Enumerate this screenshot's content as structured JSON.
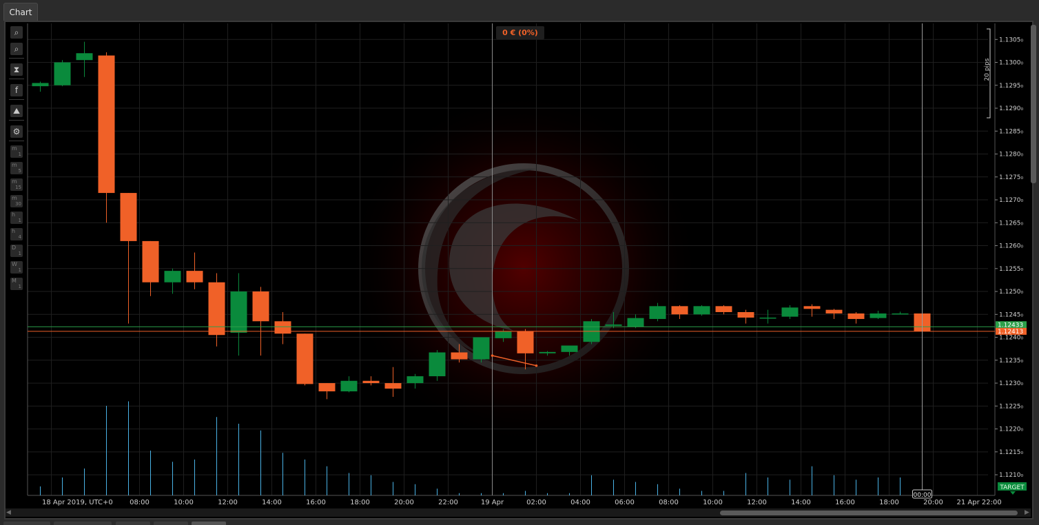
{
  "tab": {
    "label": "Chart"
  },
  "pnl": {
    "text": "0 € (0%)"
  },
  "pips_label": "20 pips",
  "toolbar": {
    "timeframes": [
      {
        "main": "m",
        "sub": "1"
      },
      {
        "main": "m",
        "sub": "5"
      },
      {
        "main": "m",
        "sub": "15"
      },
      {
        "main": "m",
        "sub": "30"
      },
      {
        "main": "h",
        "sub": "1"
      },
      {
        "main": "h",
        "sub": "4"
      },
      {
        "main": "D",
        "sub": "1"
      },
      {
        "main": "W",
        "sub": "1"
      },
      {
        "main": "M",
        "sub": "1"
      }
    ]
  },
  "colors": {
    "bull": "#0a8a3c",
    "bear": "#f06128",
    "volume": "#4ab4e8",
    "ask_line": "#2aa04a",
    "bid_line": "#f06128"
  },
  "chart_data": {
    "type": "candlestick",
    "symbol_timeframe": "H1",
    "ylim": [
      1.12055,
      1.13085
    ],
    "y_ticks": [
      "1.1305₀",
      "1.1300₀",
      "1.1295₀",
      "1.1290₀",
      "1.1285₀",
      "1.1280₀",
      "1.1275₀",
      "1.1270₀",
      "1.1265₀",
      "1.1260₀",
      "1.1255₀",
      "1.1250₀",
      "1.1245₀",
      "1.1240₀",
      "1.1235₀",
      "1.1230₀",
      "1.1225₀",
      "1.1220₀",
      "1.1215₀",
      "1.1210₀"
    ],
    "x_labels": [
      {
        "slot": 0.5,
        "text": "18 Apr 2019, UTC+0"
      },
      {
        "slot": 4.5,
        "text": "08:00"
      },
      {
        "slot": 6.5,
        "text": "10:00"
      },
      {
        "slot": 8.5,
        "text": "12:00"
      },
      {
        "slot": 10.5,
        "text": "14:00"
      },
      {
        "slot": 12.5,
        "text": "16:00"
      },
      {
        "slot": 14.5,
        "text": "18:00"
      },
      {
        "slot": 16.5,
        "text": "20:00"
      },
      {
        "slot": 18.5,
        "text": "22:00"
      },
      {
        "slot": 20.5,
        "text": "19 Apr"
      },
      {
        "slot": 22.5,
        "text": "02:00"
      },
      {
        "slot": 24.5,
        "text": "04:00"
      },
      {
        "slot": 26.5,
        "text": "06:00"
      },
      {
        "slot": 28.5,
        "text": "08:00"
      },
      {
        "slot": 30.5,
        "text": "10:00"
      },
      {
        "slot": 32.5,
        "text": "12:00"
      },
      {
        "slot": 34.5,
        "text": "14:00"
      },
      {
        "slot": 36.5,
        "text": "16:00"
      },
      {
        "slot": 38.5,
        "text": "18:00"
      },
      {
        "slot": 40.5,
        "text": "20:00"
      },
      {
        "slot": 42.5,
        "text": "21 Apr 22:00"
      }
    ],
    "candles": [
      {
        "o": 1.12948,
        "h": 1.12958,
        "l": 1.12936,
        "c": 1.12955
      },
      {
        "o": 1.1295,
        "h": 1.13005,
        "l": 1.12948,
        "c": 1.13
      },
      {
        "o": 1.13005,
        "h": 1.13045,
        "l": 1.12968,
        "c": 1.1302
      },
      {
        "o": 1.13015,
        "h": 1.13022,
        "l": 1.1265,
        "c": 1.12715
      },
      {
        "o": 1.12715,
        "h": 1.12715,
        "l": 1.1243,
        "c": 1.1261
      },
      {
        "o": 1.1261,
        "h": 1.1261,
        "l": 1.1249,
        "c": 1.1252
      },
      {
        "o": 1.1252,
        "h": 1.1255,
        "l": 1.12495,
        "c": 1.12545
      },
      {
        "o": 1.12545,
        "h": 1.12585,
        "l": 1.12505,
        "c": 1.1252
      },
      {
        "o": 1.1252,
        "h": 1.1254,
        "l": 1.1238,
        "c": 1.12405
      },
      {
        "o": 1.1241,
        "h": 1.1254,
        "l": 1.1236,
        "c": 1.125
      },
      {
        "o": 1.125,
        "h": 1.1251,
        "l": 1.1236,
        "c": 1.12435
      },
      {
        "o": 1.12435,
        "h": 1.12455,
        "l": 1.12385,
        "c": 1.12408
      },
      {
        "o": 1.12408,
        "h": 1.12408,
        "l": 1.12295,
        "c": 1.12298
      },
      {
        "o": 1.123,
        "h": 1.123,
        "l": 1.12265,
        "c": 1.12282
      },
      {
        "o": 1.12282,
        "h": 1.12315,
        "l": 1.1228,
        "c": 1.12305
      },
      {
        "o": 1.12305,
        "h": 1.12315,
        "l": 1.12295,
        "c": 1.123
      },
      {
        "o": 1.123,
        "h": 1.12335,
        "l": 1.1227,
        "c": 1.12288
      },
      {
        "o": 1.123,
        "h": 1.1232,
        "l": 1.12288,
        "c": 1.12315
      },
      {
        "o": 1.12315,
        "h": 1.12372,
        "l": 1.12305,
        "c": 1.12367
      },
      {
        "o": 1.12367,
        "h": 1.12385,
        "l": 1.12345,
        "c": 1.12352
      },
      {
        "o": 1.12352,
        "h": 1.124,
        "l": 1.12345,
        "c": 1.124
      },
      {
        "o": 1.12398,
        "h": 1.12418,
        "l": 1.1239,
        "c": 1.12413
      },
      {
        "o": 1.12413,
        "h": 1.12418,
        "l": 1.1233,
        "c": 1.12365
      },
      {
        "o": 1.12365,
        "h": 1.1237,
        "l": 1.1236,
        "c": 1.12368
      },
      {
        "o": 1.12368,
        "h": 1.1238,
        "l": 1.1236,
        "c": 1.12382
      },
      {
        "o": 1.1239,
        "h": 1.1244,
        "l": 1.12385,
        "c": 1.12435
      },
      {
        "o": 1.12425,
        "h": 1.12455,
        "l": 1.1242,
        "c": 1.12428
      },
      {
        "o": 1.12423,
        "h": 1.1245,
        "l": 1.1242,
        "c": 1.12442
      },
      {
        "o": 1.1244,
        "h": 1.12475,
        "l": 1.12435,
        "c": 1.12468
      },
      {
        "o": 1.12468,
        "h": 1.1247,
        "l": 1.1244,
        "c": 1.1245
      },
      {
        "o": 1.1245,
        "h": 1.1247,
        "l": 1.12447,
        "c": 1.12468
      },
      {
        "o": 1.12468,
        "h": 1.1247,
        "l": 1.1245,
        "c": 1.12455
      },
      {
        "o": 1.12455,
        "h": 1.1246,
        "l": 1.1243,
        "c": 1.12443
      },
      {
        "o": 1.12443,
        "h": 1.1246,
        "l": 1.1243,
        "c": 1.12443
      },
      {
        "o": 1.12445,
        "h": 1.1247,
        "l": 1.1244,
        "c": 1.12465
      },
      {
        "o": 1.12468,
        "h": 1.12472,
        "l": 1.12445,
        "c": 1.12462
      },
      {
        "o": 1.1246,
        "h": 1.12462,
        "l": 1.1244,
        "c": 1.12452
      },
      {
        "o": 1.12452,
        "h": 1.12455,
        "l": 1.1243,
        "c": 1.1244
      },
      {
        "o": 1.12442,
        "h": 1.12458,
        "l": 1.1244,
        "c": 1.12452
      },
      {
        "o": 1.12452,
        "h": 1.12456,
        "l": 1.1245,
        "c": 1.12452
      },
      {
        "o": 1.12452,
        "h": 1.1247,
        "l": 1.1237,
        "c": 1.12413
      }
    ],
    "volume": [
      0.2,
      0.4,
      0.6,
      2.0,
      2.1,
      1.0,
      0.75,
      0.8,
      1.75,
      1.6,
      1.45,
      0.95,
      0.8,
      0.65,
      0.5,
      0.45,
      0.3,
      0.25,
      0.15,
      0.05,
      0.05,
      0.05,
      0.1,
      0.05,
      0.05,
      0.45,
      0.35,
      0.3,
      0.25,
      0.15,
      0.1,
      0.1,
      0.5,
      0.4,
      0.35,
      0.65,
      0.45,
      0.35,
      0.4,
      0.4,
      1.25
    ],
    "ask_price": "1.12433",
    "bid_price": "1.12413",
    "ask_value": 1.12423,
    "bid_value": 1.12413,
    "cursor_time_label": "00:00",
    "target_label": "TARGET",
    "trend_line": {
      "from": [
        20.5,
        1.1236
      ],
      "to": [
        22.5,
        1.12338
      ]
    }
  }
}
